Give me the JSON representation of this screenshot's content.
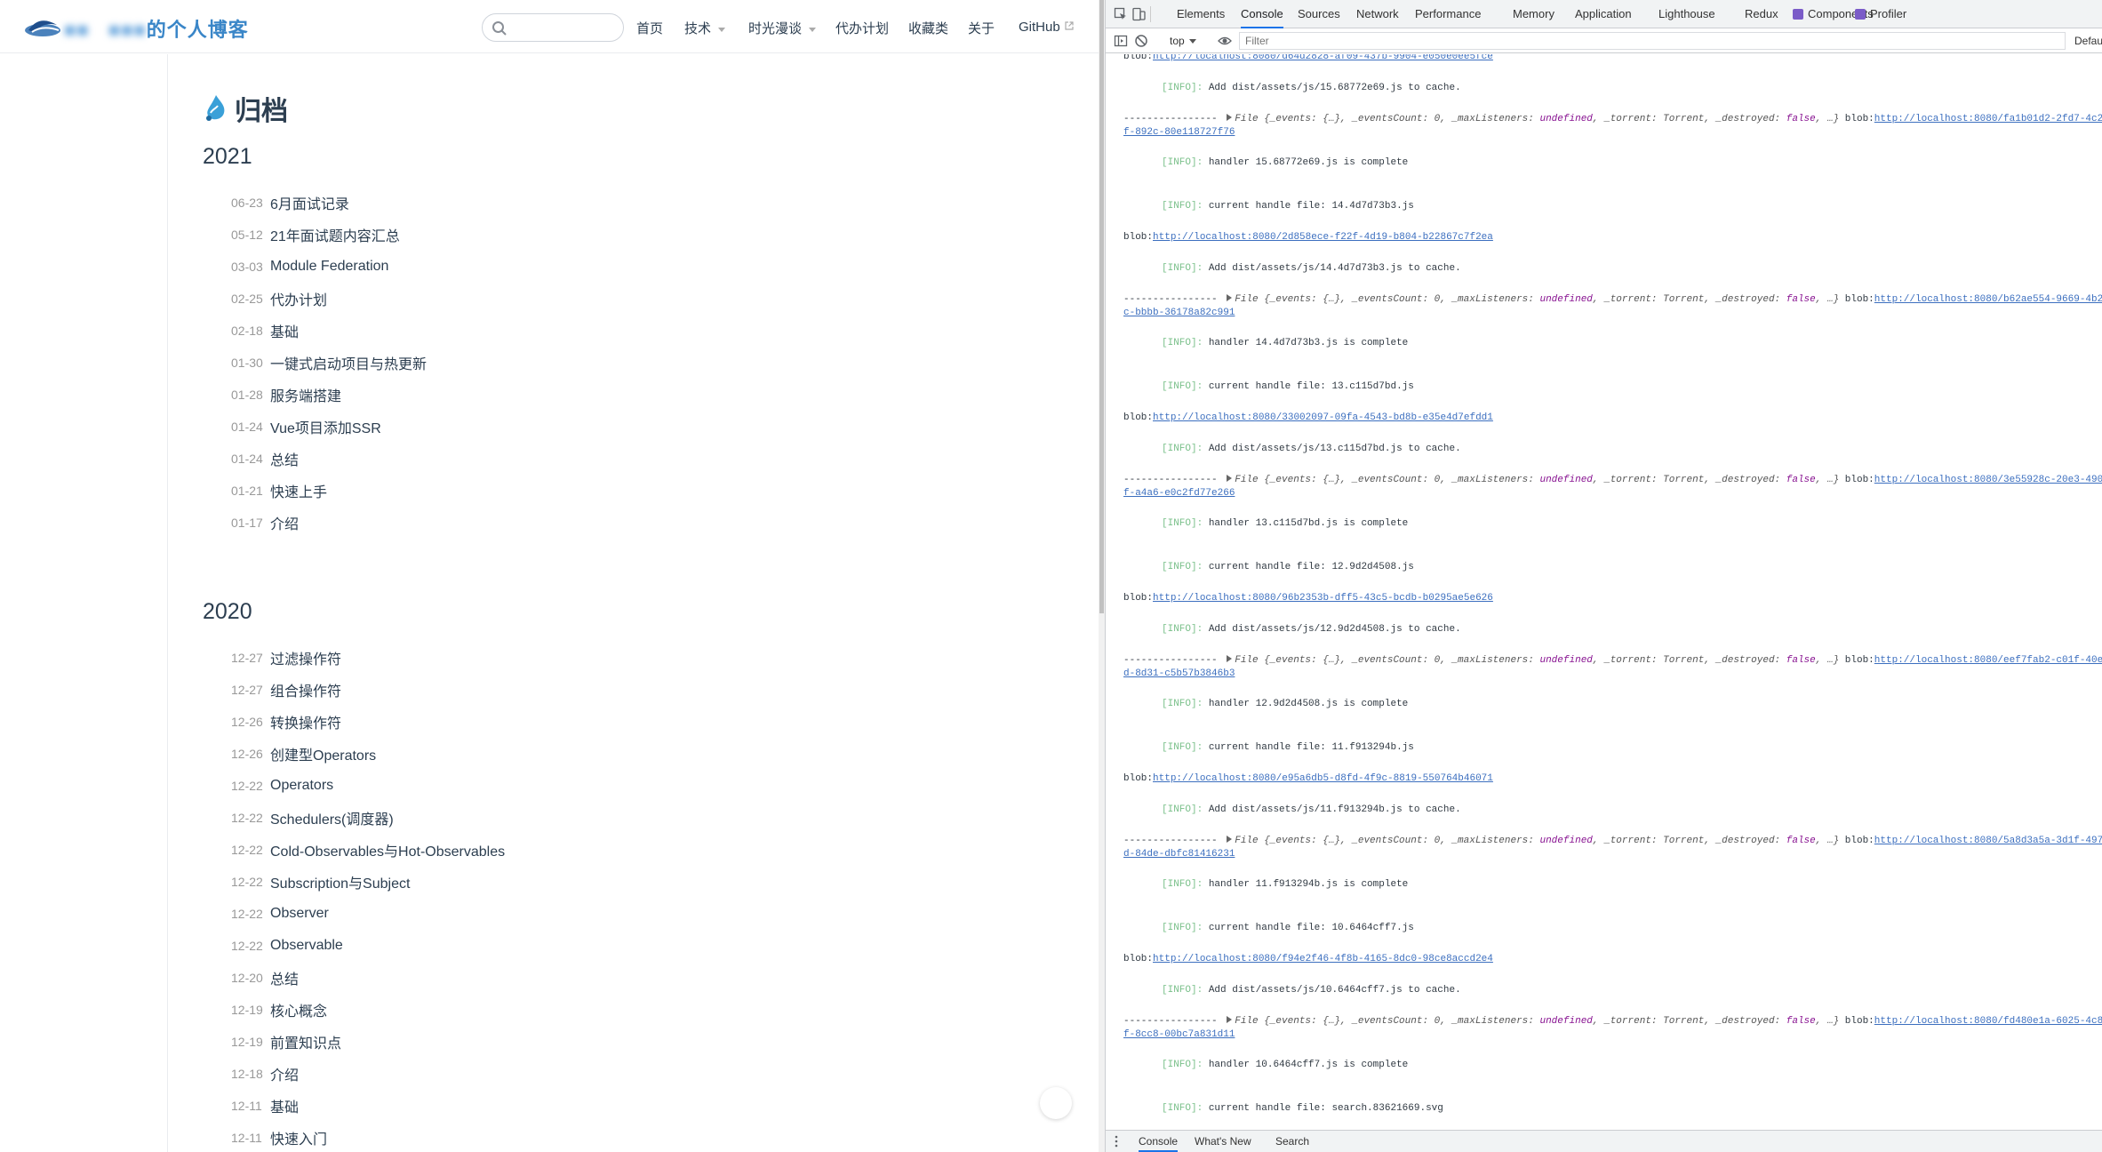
{
  "blog": {
    "site_title_visible": "的个人博客",
    "search_placeholder": "",
    "nav": [
      {
        "label": "首页",
        "dropdown": false,
        "external": false
      },
      {
        "label": "技术",
        "dropdown": true,
        "external": false
      },
      {
        "label": "时光漫谈",
        "dropdown": true,
        "external": false
      },
      {
        "label": "代办计划",
        "dropdown": false,
        "external": false
      },
      {
        "label": "收藏类",
        "dropdown": false,
        "external": false
      },
      {
        "label": "关于",
        "dropdown": false,
        "external": false
      },
      {
        "label": "GitHub",
        "dropdown": false,
        "external": true
      }
    ],
    "page_title": "归档",
    "years": [
      {
        "year": "2021",
        "posts": [
          {
            "date": "06-23",
            "title": "6月面试记录"
          },
          {
            "date": "05-12",
            "title": "21年面试题内容汇总"
          },
          {
            "date": "03-03",
            "title": "Module Federation"
          },
          {
            "date": "02-25",
            "title": "代办计划"
          },
          {
            "date": "02-18",
            "title": "基础"
          },
          {
            "date": "01-30",
            "title": "一键式启动项目与热更新"
          },
          {
            "date": "01-28",
            "title": "服务端搭建"
          },
          {
            "date": "01-24",
            "title": "Vue项目添加SSR"
          },
          {
            "date": "01-24",
            "title": "总结"
          },
          {
            "date": "01-21",
            "title": "快速上手"
          },
          {
            "date": "01-17",
            "title": "介绍"
          }
        ]
      },
      {
        "year": "2020",
        "posts": [
          {
            "date": "12-27",
            "title": "过滤操作符"
          },
          {
            "date": "12-27",
            "title": "组合操作符"
          },
          {
            "date": "12-26",
            "title": "转换操作符"
          },
          {
            "date": "12-26",
            "title": "创建型Operators"
          },
          {
            "date": "12-22",
            "title": "Operators"
          },
          {
            "date": "12-22",
            "title": "Schedulers(调度器)"
          },
          {
            "date": "12-22",
            "title": "Cold-Observables与Hot-Observables"
          },
          {
            "date": "12-22",
            "title": "Subscription与Subject"
          },
          {
            "date": "12-22",
            "title": "Observer"
          },
          {
            "date": "12-22",
            "title": "Observable"
          },
          {
            "date": "12-20",
            "title": "总结"
          },
          {
            "date": "12-19",
            "title": "核心概念"
          },
          {
            "date": "12-19",
            "title": "前置知识点"
          },
          {
            "date": "12-18",
            "title": "介绍"
          },
          {
            "date": "12-11",
            "title": "基础"
          },
          {
            "date": "12-11",
            "title": "快速入门"
          }
        ]
      }
    ]
  },
  "devtools": {
    "tabs": [
      "Elements",
      "Console",
      "Sources",
      "Network",
      "Performance",
      "Memory",
      "Application",
      "Lighthouse",
      "Redux",
      "Components",
      "Profiler"
    ],
    "active_tab": "Console",
    "context": "top",
    "filter_placeholder": "Filter",
    "levels_label": "Defau",
    "drawer_tabs": [
      "Console",
      "What's New",
      "Search"
    ],
    "colors": {
      "info_tag": "#7ac08a",
      "link": "#3c6fbf",
      "keyword": "#881391",
      "active_tab": "#1a73e8",
      "plugin_icon": "#7b5cc8"
    },
    "messages": [
      {
        "kind": "blob",
        "url": "http://localhost:8080/d64d2828-af09-437b-9904-e050e0ee5fce",
        "y": 0
      },
      {
        "kind": "info",
        "text": "Add dist/assets/js/15.68772e69.js to cache."
      },
      {
        "kind": "file",
        "url": "http://localhost:8080/fa1b01d2-2fd7-4c2",
        "cont": "f-892c-80e118727f76"
      },
      {
        "kind": "info",
        "text": "handler 15.68772e69.js is complete"
      },
      {
        "kind": "info",
        "text": "current handle file: 14.4d7d73b3.js"
      },
      {
        "kind": "blob",
        "url": "http://localhost:8080/2d858ece-f22f-4d19-b804-b22867c7f2ea"
      },
      {
        "kind": "info",
        "text": "Add dist/assets/js/14.4d7d73b3.js to cache."
      },
      {
        "kind": "file",
        "url": "http://localhost:8080/b62ae554-9669-4b2",
        "cont": "c-bbbb-36178a82c991"
      },
      {
        "kind": "info",
        "text": "handler 14.4d7d73b3.js is complete"
      },
      {
        "kind": "info",
        "text": "current handle file: 13.c115d7bd.js"
      },
      {
        "kind": "blob",
        "url": "http://localhost:8080/33002097-09fa-4543-bd8b-e35e4d7efdd1"
      },
      {
        "kind": "info",
        "text": "Add dist/assets/js/13.c115d7bd.js to cache."
      },
      {
        "kind": "file",
        "url": "http://localhost:8080/3e55928c-20e3-490",
        "cont": "f-a4a6-e0c2fd77e266"
      },
      {
        "kind": "info",
        "text": "handler 13.c115d7bd.js is complete"
      },
      {
        "kind": "info",
        "text": "current handle file: 12.9d2d4508.js"
      },
      {
        "kind": "blob",
        "url": "http://localhost:8080/96b2353b-dff5-43c5-bcdb-b0295ae5e626"
      },
      {
        "kind": "info",
        "text": "Add dist/assets/js/12.9d2d4508.js to cache."
      },
      {
        "kind": "file",
        "url": "http://localhost:8080/eef7fab2-c01f-40e",
        "cont": "d-8d31-c5b57b3846b3"
      },
      {
        "kind": "info",
        "text": "handler 12.9d2d4508.js is complete"
      },
      {
        "kind": "info",
        "text": "current handle file: 11.f913294b.js"
      },
      {
        "kind": "blob",
        "url": "http://localhost:8080/e95a6db5-d8fd-4f9c-8819-550764b46071"
      },
      {
        "kind": "info",
        "text": "Add dist/assets/js/11.f913294b.js to cache."
      },
      {
        "kind": "file",
        "url": "http://localhost:8080/5a8d3a5a-3d1f-497",
        "cont": "d-84de-dbfc81416231"
      },
      {
        "kind": "info",
        "text": "handler 11.f913294b.js is complete"
      },
      {
        "kind": "info",
        "text": "current handle file: 10.6464cff7.js"
      },
      {
        "kind": "blob",
        "url": "http://localhost:8080/f94e2f46-4f8b-4165-8dc0-98ce8accd2e4"
      },
      {
        "kind": "info",
        "text": "Add dist/assets/js/10.6464cff7.js to cache."
      },
      {
        "kind": "file",
        "url": "http://localhost:8080/fd480e1a-6025-4c8",
        "cont": "f-8cc8-00bc7a831d11"
      },
      {
        "kind": "info",
        "text": "handler 10.6464cff7.js is complete"
      },
      {
        "kind": "info",
        "text": "current handle file: search.83621669.svg"
      }
    ],
    "info_tag": "[INFO]:",
    "blob_prefix": "blob:",
    "file_prefix": "---------------- ",
    "file_obj": "File {_events: {…}, _eventsCount: 0, _maxListeners: ",
    "kw_undefined": "undefined",
    "file_mid": ", _torrent: Torrent, _destroyed: ",
    "kw_false": "false",
    "file_end": ", …} "
  }
}
